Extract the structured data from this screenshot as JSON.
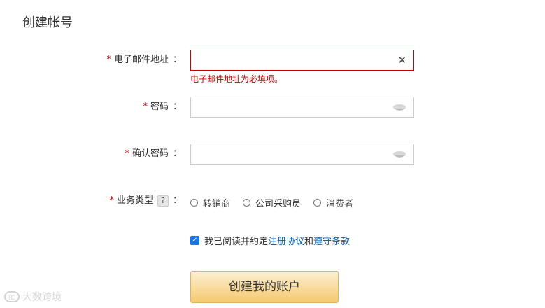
{
  "page": {
    "title": "创建帐号"
  },
  "form": {
    "email": {
      "label": "电子邮件地址",
      "value": "",
      "error": "电子邮件地址为必填项。",
      "clear_icon": "close-icon"
    },
    "password": {
      "label": "密码",
      "value": "",
      "icon": "eye-icon"
    },
    "confirm_password": {
      "label": "确认密码",
      "value": "",
      "icon": "eye-icon"
    },
    "business_type": {
      "label": "业务类型",
      "help": "?",
      "options": [
        "转销商",
        "公司采购员",
        "消费者"
      ],
      "selected": null
    },
    "agreement": {
      "checked": true,
      "prefix": "我已阅读并约定",
      "link1": "注册协议",
      "conj": "和",
      "link2": "遵守条款"
    },
    "submit_label": "创建我的账户"
  },
  "required_mark": "*",
  "colon": "：",
  "watermark": {
    "logo": "IC",
    "text": "大数跨境"
  },
  "colors": {
    "error": "#c40000",
    "link": "#0066c0",
    "checkbox": "#1a73e8",
    "button_top": "#fdf0d3",
    "button_bottom": "#f5c96e"
  }
}
